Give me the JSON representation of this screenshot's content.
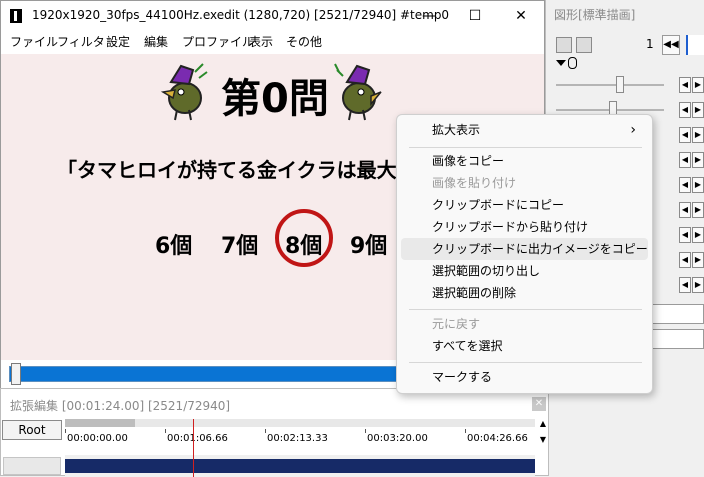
{
  "window": {
    "title": "1920x1920_30fps_44100Hz.exedit (1280,720)  [2521/72940]  #temp0",
    "minimize": "—",
    "maximize": "☐",
    "close": "✕"
  },
  "menu": [
    "ファイル",
    "フィルタ",
    "設定",
    "編集",
    "プロファイル",
    "表示",
    "その他"
  ],
  "preview": {
    "title": "第0問",
    "question": "「タマヒロイが持てる金イクラは最大",
    "choices": [
      "6個",
      "7個",
      "8個",
      "9個"
    ],
    "highlighted_choice": "8個"
  },
  "dock": {
    "title": "図形[標準描画]",
    "frame_number": "1",
    "prev_label": "◀◀"
  },
  "timeline": {
    "title": "拡張編集 [00:01:24.00] [2521/72940]",
    "root_label": "Root",
    "close_label": "✕",
    "ticks": [
      "00:00:00.00",
      "00:01:06.66",
      "00:02:13.33",
      "00:03:20.00",
      "00:04:26.66"
    ]
  },
  "context_menu": {
    "items": [
      {
        "label": "拡大表示",
        "submenu": true,
        "enabled": true
      },
      {
        "label": "画像をコピー",
        "enabled": true
      },
      {
        "label": "画像を貼り付け",
        "enabled": false
      },
      {
        "label": "クリップボードにコピー",
        "enabled": true
      },
      {
        "label": "クリップボードから貼り付け",
        "enabled": true
      },
      {
        "label": "クリップボードに出力イメージをコピー",
        "enabled": true,
        "hover": true
      },
      {
        "label": "選択範囲の切り出し",
        "enabled": true
      },
      {
        "label": "選択範囲の削除",
        "enabled": true
      },
      {
        "label": "元に戻す",
        "enabled": false
      },
      {
        "label": "すべてを選択",
        "enabled": true
      },
      {
        "label": "マークする",
        "enabled": true
      }
    ],
    "chevron": "›"
  }
}
